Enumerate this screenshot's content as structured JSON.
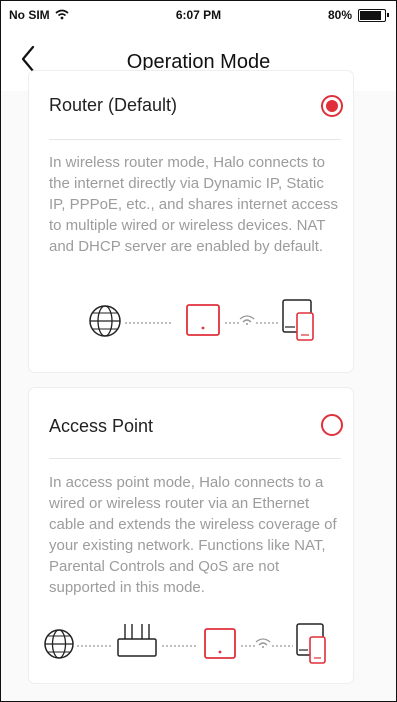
{
  "status_bar": {
    "carrier": "No SIM",
    "time": "6:07 PM",
    "battery": "80%"
  },
  "nav": {
    "title": "Operation Mode"
  },
  "modes": [
    {
      "title": "Router (Default)",
      "selected": true,
      "description": "In wireless router mode, Halo connects to the internet directly via Dynamic IP, Static IP, PPPoE, etc., and shares internet access to multiple wired or wireless devices. NAT and DHCP server are enabled by default.",
      "diagram_icons": [
        "globe-icon",
        "halo-unit-icon",
        "wifi-icon",
        "devices-icon"
      ]
    },
    {
      "title": "Access Point",
      "selected": false,
      "description": "In access point mode, Halo connects to a wired or wireless router via an Ethernet cable and extends the wireless coverage of your existing network. Functions like NAT, Parental Controls and QoS are not supported in this mode.",
      "diagram_icons": [
        "globe-icon",
        "router-icon",
        "halo-unit-icon",
        "wifi-icon",
        "devices-icon"
      ]
    }
  ],
  "colors": {
    "accent": "#e0303b",
    "desc_text": "#9c9c9c"
  }
}
